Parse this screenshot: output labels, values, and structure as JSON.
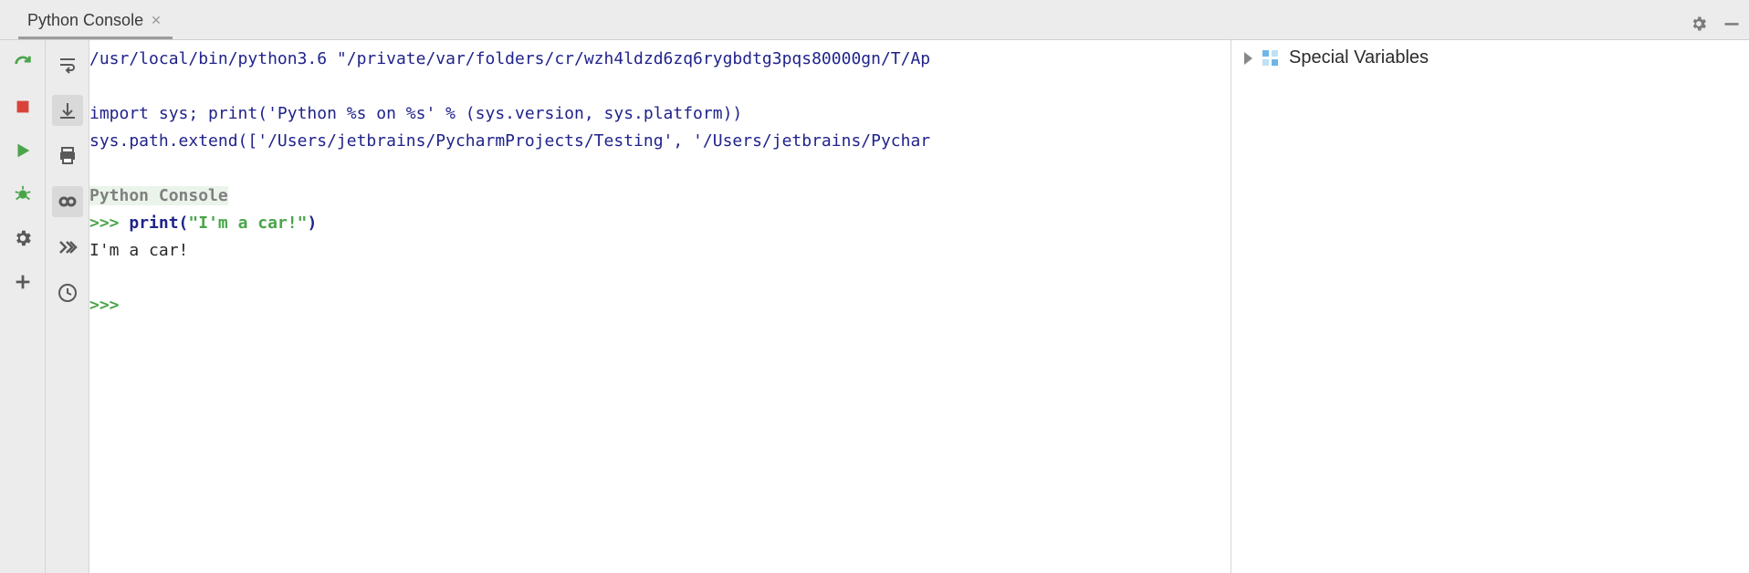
{
  "header": {
    "tab_label": "Python Console"
  },
  "console": {
    "line1": "/usr/local/bin/python3.6 \"/private/var/folders/cr/wzh4ldzd6zq6rygbdtg3pqs80000gn/T/Ap",
    "line_blank1": " ",
    "line2": "import sys; print('Python %s on %s' % (sys.version, sys.platform))",
    "line3": "sys.path.extend(['/Users/jetbrains/PycharmProjects/Testing', '/Users/jetbrains/Pychar",
    "line_blank2": " ",
    "banner": "Python Console",
    "prompt1": ">>> ",
    "call_prefix": "print(",
    "call_str": "\"I'm a car!\"",
    "call_suffix": ")",
    "output": "I'm a car!",
    "line_blank3": " ",
    "prompt2": ">>> "
  },
  "vars": {
    "special_label": "Special Variables"
  }
}
